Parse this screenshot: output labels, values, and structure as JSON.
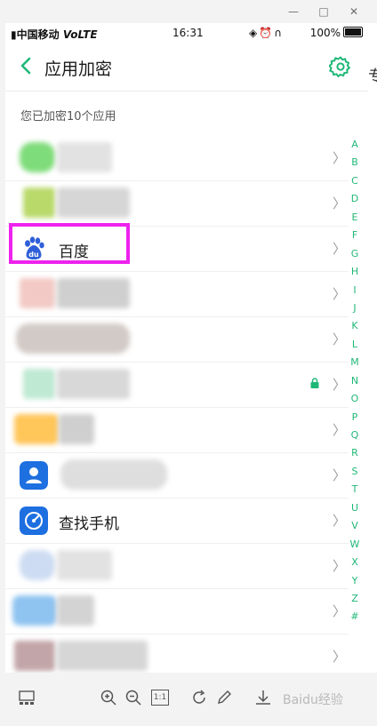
{
  "window": {
    "controls": [
      "—",
      "□",
      "✕"
    ]
  },
  "side_text": "专",
  "status": {
    "carrier": "中国移动",
    "volte": "VoLTE",
    "time": "16:31",
    "battery": "100%"
  },
  "header": {
    "title": "应用加密"
  },
  "summary": "您已加密10个应用",
  "apps": [
    {
      "name": "",
      "locked": false
    },
    {
      "name": "",
      "locked": false
    },
    {
      "name": "百度",
      "locked": false
    },
    {
      "name": "",
      "locked": false
    },
    {
      "name": "",
      "locked": false
    },
    {
      "name": "",
      "locked": true
    },
    {
      "name": "",
      "locked": false
    },
    {
      "name": "",
      "locked": false
    },
    {
      "name": "查找手机",
      "locked": false
    },
    {
      "name": "",
      "locked": false
    },
    {
      "name": "",
      "locked": false
    },
    {
      "name": "",
      "locked": false
    }
  ],
  "chevron": "〉",
  "alphabet": [
    "A",
    "B",
    "C",
    "D",
    "E",
    "F",
    "G",
    "H",
    "I",
    "J",
    "K",
    "L",
    "M",
    "N",
    "O",
    "P",
    "Q",
    "R",
    "S",
    "T",
    "U",
    "V",
    "W",
    "X",
    "Y",
    "Z",
    "#"
  ],
  "toolbar": {
    "zoom_reset": "1:1",
    "watermark": "Baidu经验"
  },
  "colors": {
    "accent": "#1fb877",
    "highlight": "#ee22ee",
    "baidu_blue": "#2f5fd8",
    "findphone_blue": "#1e6fe0"
  }
}
